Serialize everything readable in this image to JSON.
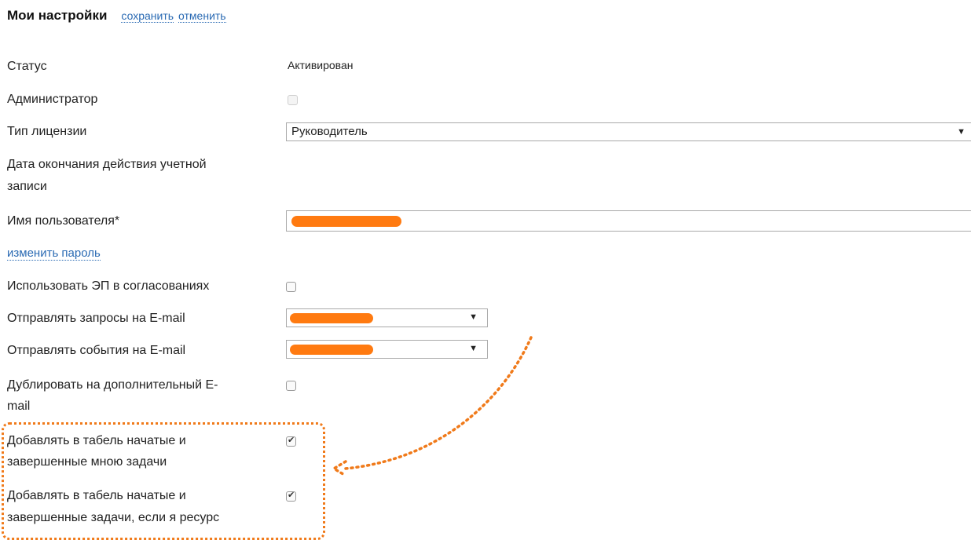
{
  "header": {
    "title": "Мои настройки",
    "save_label": "сохранить",
    "cancel_label": "отменить"
  },
  "fields": {
    "status_label": "Статус",
    "status_value": "Активирован",
    "admin_label": "Администратор",
    "admin_checked": false,
    "license_label": "Тип лицензии",
    "license_value": "Руководитель",
    "expiry_label_line1": "Дата окончания действия учетной",
    "expiry_label_line2": "записи",
    "username_label": "Имя пользователя*",
    "change_password_label": "изменить пароль",
    "use_ep_label": "Использовать ЭП в согласованиях",
    "use_ep_checked": false,
    "send_requests_label": "Отправлять запросы на E-mail",
    "send_events_label": "Отправлять события на E-mail",
    "duplicate_label_line1": "Дублировать на дополнительный E-",
    "duplicate_label_line2": "mail",
    "duplicate_checked": false,
    "add_started_mine_line1": "Добавлять в табель начатые и",
    "add_started_mine_line2": "завершенные мною задачи",
    "add_started_mine_checked": true,
    "add_started_resource_line1": "Добавлять в табель начатые и",
    "add_started_resource_line2": "завершенные задачи, если я ресурс",
    "add_started_resource_checked": true
  },
  "icons": {
    "dropdown_arrow": "▼",
    "check_mark": "✔"
  },
  "colors": {
    "link": "#2a6ab3",
    "annotation": "#f07a1a",
    "redaction": "#ff7a10"
  }
}
